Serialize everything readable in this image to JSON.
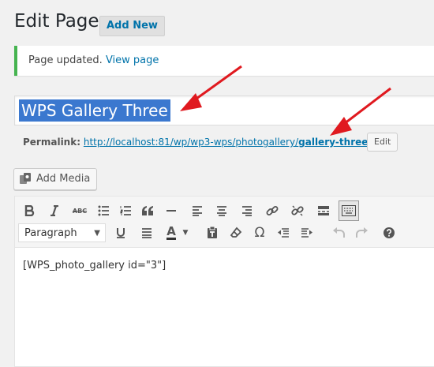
{
  "header": {
    "title": "Edit Page",
    "add_new_label": "Add New"
  },
  "notice": {
    "text": "Page updated.",
    "link": "View page",
    "accent_color": "#46b450"
  },
  "title_field": {
    "value": "WPS Gallery Three",
    "selection_color": "#3b78cf"
  },
  "permalink": {
    "label": "Permalink:",
    "url_base": "http://localhost:81/wp/wp3-wps/photogallery/",
    "slug": "gallery-three",
    "url_tail": "/",
    "edit_label": "Edit"
  },
  "media": {
    "add_media_label": "Add Media"
  },
  "editor": {
    "format_value": "Paragraph",
    "content": "[WPS_photo_gallery id=\"3\"]",
    "toolbar_row1": [
      "bold-icon",
      "italic-icon",
      "strikethrough-icon",
      "bullet-list-icon",
      "numbered-list-icon",
      "blockquote-icon",
      "horizontal-line-icon",
      "align-left-icon",
      "align-center-icon",
      "align-right-icon",
      "link-icon",
      "unlink-icon",
      "read-more-icon",
      "toolbar-toggle-icon"
    ],
    "toolbar_row2": [
      "underline-icon",
      "justify-icon",
      "text-color-icon",
      "paste-text-icon",
      "clear-formatting-icon",
      "special-character-icon",
      "outdent-icon",
      "indent-icon",
      "undo-icon",
      "redo-icon",
      "help-icon"
    ],
    "glyphs": {
      "strike": "ABC",
      "omega": "Ω",
      "text_color": "A"
    }
  },
  "annotation_color": "#e0191f",
  "link_color": "#0073aa"
}
